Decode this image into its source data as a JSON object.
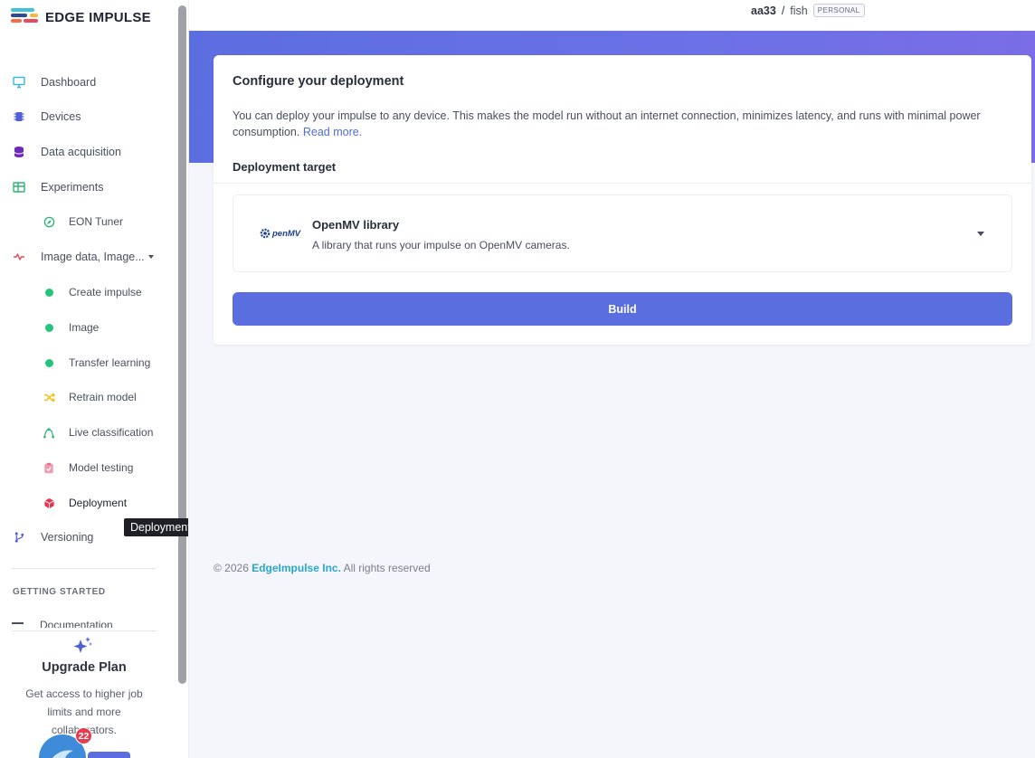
{
  "app": {
    "logo_text": "EDGE IMPULSE"
  },
  "sidebar": {
    "items": [
      {
        "label": "Dashboard",
        "icon": "monitor-icon"
      },
      {
        "label": "Devices",
        "icon": "chip-icon"
      },
      {
        "label": "Data acquisition",
        "icon": "database-icon"
      },
      {
        "label": "Experiments",
        "icon": "table-icon"
      },
      {
        "label": "EON Tuner",
        "icon": "compass-icon"
      },
      {
        "label": "Image data, Image...",
        "icon": "pulse-icon"
      },
      {
        "label": "Create impulse",
        "icon": "green-dot-icon"
      },
      {
        "label": "Image",
        "icon": "green-dot-icon"
      },
      {
        "label": "Transfer learning",
        "icon": "green-dot-icon"
      },
      {
        "label": "Retrain model",
        "icon": "shuffle-icon"
      },
      {
        "label": "Live classification",
        "icon": "network-icon"
      },
      {
        "label": "Model testing",
        "icon": "clipboard-check-icon"
      },
      {
        "label": "Deployment",
        "icon": "cube-icon"
      },
      {
        "label": "Versioning",
        "icon": "git-branch-icon"
      }
    ],
    "tooltip": "Deployment",
    "section_label": "GETTING STARTED",
    "docs_peek": "Documentation"
  },
  "upgrade": {
    "title": "Upgrade Plan",
    "text": "Get access to higher job limits and more collaborators.",
    "badge_count": "22"
  },
  "topbar": {
    "user": "aa33",
    "separator": "/",
    "project": "fish",
    "tag": "PERSONAL"
  },
  "card": {
    "title": "Configure your deployment",
    "description": "You can deploy your impulse to any device. This makes the model run without an internet connection, minimizes latency, and runs with minimal power consumption.",
    "read_more": "Read more.",
    "target_label": "Deployment target",
    "target": {
      "logo_text": "penMV",
      "name": "OpenMV library",
      "description": "A library that runs your impulse on OpenMV cameras."
    },
    "build_label": "Build"
  },
  "footer": {
    "copyright": "© 2026",
    "brand": "EdgeImpulse Inc.",
    "rights": "All rights reserved"
  },
  "colors": {
    "accent": "#5b6ee0",
    "hero_start": "#5b6ee0",
    "hero_end": "#7a6de6",
    "status_green": "#22c57a",
    "badge_red": "#e43d4e",
    "footer_brand": "#2aa7c9"
  }
}
